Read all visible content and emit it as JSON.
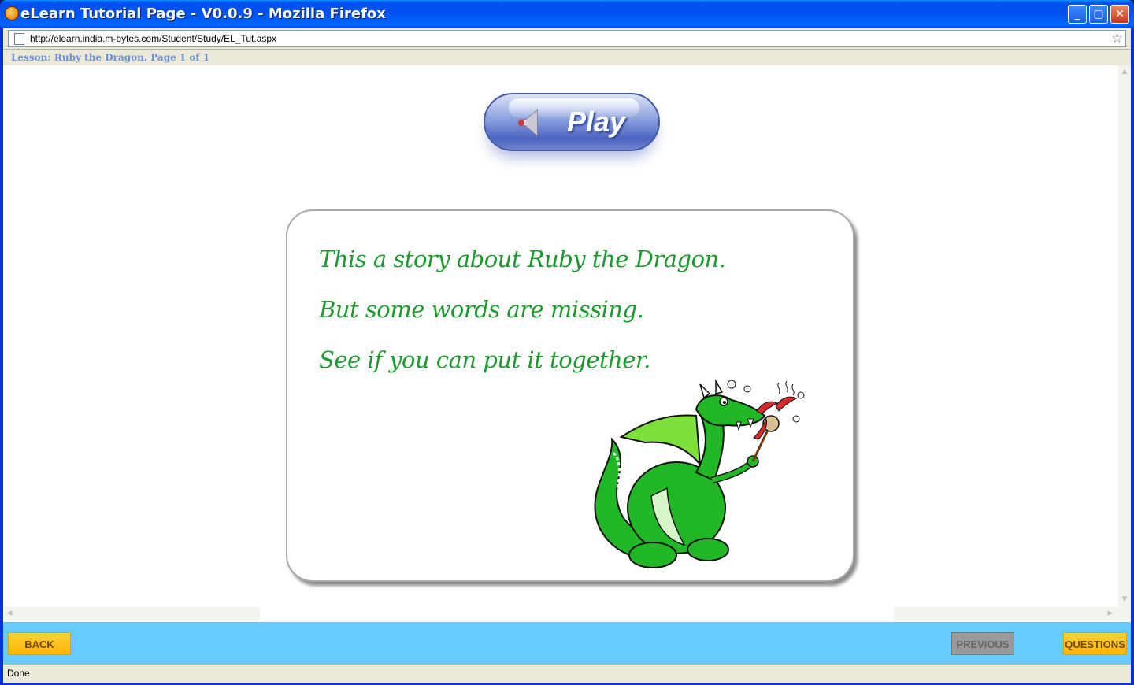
{
  "window": {
    "title": "eLearn Tutorial Page - V0.0.9 - Mozilla Firefox",
    "controls": {
      "minimize": "minimize-icon",
      "maximize": "maximize-icon",
      "close": "close-icon"
    }
  },
  "address_bar": {
    "url": "http://elearn.india.m-bytes.com/Student/Study/EL_Tut.aspx",
    "page_icon": "page-icon",
    "bookmark_icon": "star-icon"
  },
  "lesson": {
    "header": "Lesson: Ruby the Dragon. Page 1 of 1"
  },
  "player": {
    "play_label": "Play",
    "icon": "speaker-icon"
  },
  "story": {
    "lines": [
      "This a story about Ruby the Dragon.",
      "But some words are missing.",
      "See if you can put it together."
    ],
    "illustration": "green-dragon-roasting-marshmallow"
  },
  "nav": {
    "back_label": "BACK",
    "previous_label": "PREVIOUS",
    "questions_label": "QUESTIONS"
  },
  "status": {
    "text": "Done"
  },
  "colors": {
    "titlebar": "#0054e3",
    "lesson_text": "#6b8fe0",
    "story_text": "#1a9a2c",
    "navbar": "#66ccff",
    "nav_button": "#ffc21a",
    "nav_button_disabled": "#999999"
  }
}
